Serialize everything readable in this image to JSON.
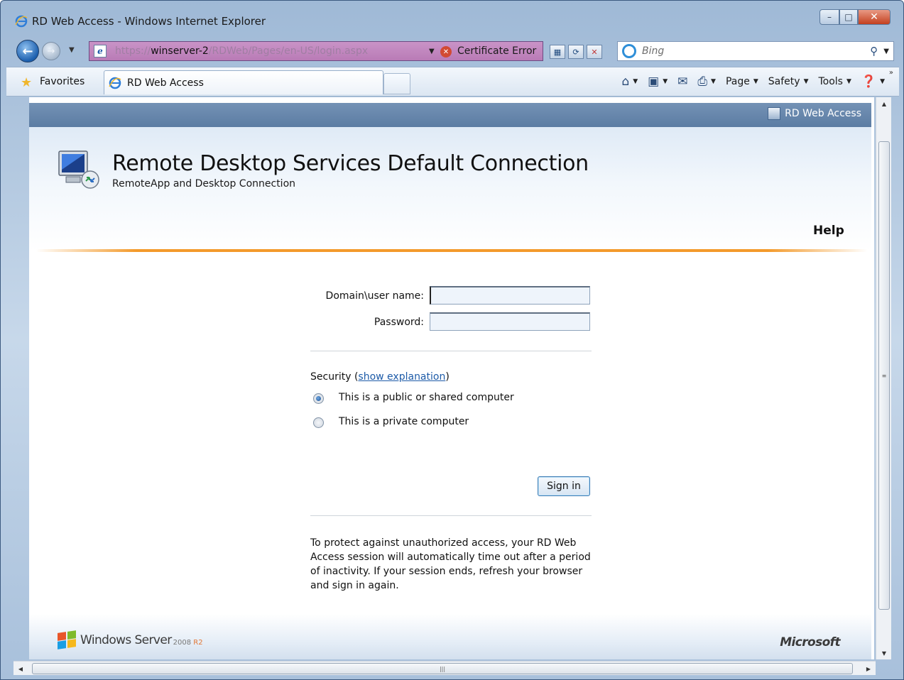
{
  "window": {
    "title": "RD Web Access - Windows Internet Explorer",
    "controls": {
      "minimize": "–",
      "maximize": "□",
      "close": "✕"
    }
  },
  "address_bar": {
    "url_prefix": "https://",
    "url_host": "winserver-2",
    "url_path": "/RDWeb/Pages/en-US/login.aspx",
    "certificate_error_label": "Certificate Error"
  },
  "search": {
    "placeholder": "Bing"
  },
  "favorites_bar": {
    "favorites_label": "Favorites"
  },
  "tab": {
    "label": "RD Web Access"
  },
  "command_bar": {
    "page_label": "Page",
    "safety_label": "Safety",
    "tools_label": "Tools"
  },
  "page": {
    "top_link_label": "RD Web Access",
    "title": "Remote Desktop Services Default Connection",
    "subtitle": "RemoteApp and Desktop Connection",
    "help_label": "Help",
    "form": {
      "username_label": "Domain\\user name:",
      "username_value": "",
      "password_label": "Password:",
      "password_value": ""
    },
    "security": {
      "label": "Security",
      "open_paren": " (",
      "explanation_link": "show explanation",
      "close_paren": ")",
      "options": [
        {
          "label": "This is a public or shared computer",
          "checked": true
        },
        {
          "label": "This is a private computer",
          "checked": false
        }
      ]
    },
    "sign_in_label": "Sign in",
    "notice": "To protect against unauthorized access, your RD Web Access session will automatically time out after a period of inactivity. If your session ends, refresh your browser and sign in again.",
    "footer": {
      "windows_server_label": "Windows Server",
      "version_label": "2008",
      "r2_label": "R2",
      "microsoft_label": "Microsoft"
    }
  },
  "colors": {
    "accent_orange": "#f39a2b",
    "header_strip": "#5b7ca3",
    "link_blue": "#1d5ba8",
    "address_bar_error": "#b97bb6"
  }
}
